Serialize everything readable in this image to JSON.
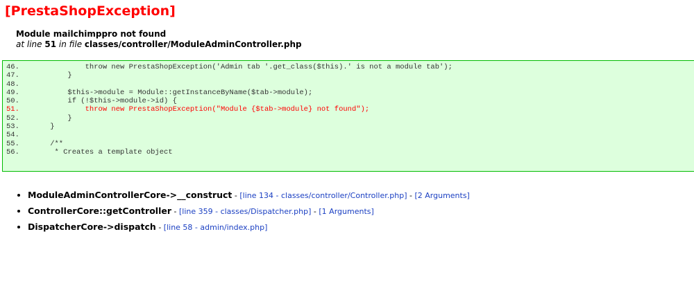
{
  "exception": {
    "title": "[PrestaShopException]",
    "message": "Module mailchimppro not found",
    "location_prefix": "at line ",
    "line": "51",
    "location_middle": " in file ",
    "file": "classes/controller/ModuleAdminController.php"
  },
  "code_lines": [
    {
      "num": "46.",
      "code": "            throw new PrestaShopException('Admin tab '.get_class($this).' is not a module tab');",
      "highlight": false
    },
    {
      "num": "47.",
      "code": "        }",
      "highlight": false
    },
    {
      "num": "48.",
      "code": "",
      "highlight": false
    },
    {
      "num": "49.",
      "code": "        $this->module = Module::getInstanceByName($tab->module);",
      "highlight": false
    },
    {
      "num": "50.",
      "code": "        if (!$this->module->id) {",
      "highlight": false
    },
    {
      "num": "51.",
      "code": "            throw new PrestaShopException(\"Module {$tab->module} not found\");",
      "highlight": true
    },
    {
      "num": "52.",
      "code": "        }",
      "highlight": false
    },
    {
      "num": "53.",
      "code": "    }",
      "highlight": false
    },
    {
      "num": "54.",
      "code": "",
      "highlight": false
    },
    {
      "num": "55.",
      "code": "    /**",
      "highlight": false
    },
    {
      "num": "56.",
      "code": "     * Creates a template object",
      "highlight": false
    }
  ],
  "trace": [
    {
      "func": "ModuleAdminControllerCore->__construct",
      "location": "[line 134 - classes/controller/Controller.php]",
      "args": "[2 Arguments]"
    },
    {
      "func": "ControllerCore::getController",
      "location": "[line 359 - classes/Dispatcher.php]",
      "args": "[1 Arguments]"
    },
    {
      "func": "DispatcherCore->dispatch",
      "location": "[line 58 - admin/index.php]",
      "args": ""
    }
  ],
  "separator": " - ",
  "colors": {
    "title": "#ff0000",
    "code_bg": "#ddffdd",
    "code_border": "#00bb00",
    "highlight": "#ff0000",
    "link": "#1a3fc2"
  }
}
